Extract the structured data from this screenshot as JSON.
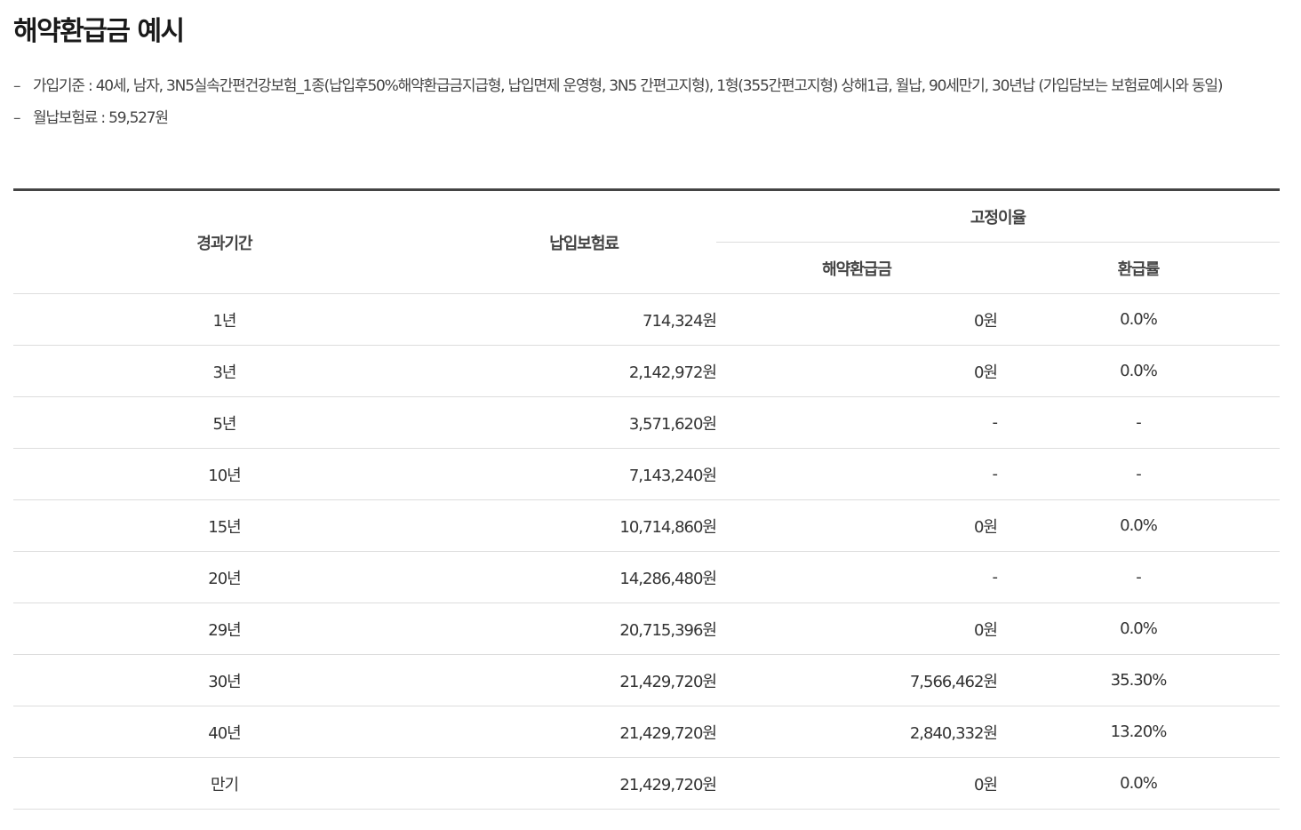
{
  "title": "해약환급금 예시",
  "notes": [
    {
      "bullet": "–",
      "text": "가입기준 : 40세, 남자, 3N5실속간편건강보험_1종(납입후50%해약환급금지급형, 납입면제 운영형, 3N5 간편고지형), 1형(355간편고지형) 상해1급, 월납, 90세만기, 30년납 (가입담보는 보험료예시와 동일)"
    },
    {
      "bullet": "–",
      "text": "월납보험료 : 59,527원"
    }
  ],
  "table": {
    "headers": {
      "period": "경과기간",
      "premium": "납입보험료",
      "group": "고정이율",
      "refund": "해약환급금",
      "rate": "환급률"
    },
    "rows": [
      {
        "period": "1년",
        "premium": "714,324원",
        "refund": "0원",
        "rate": "0.0%"
      },
      {
        "period": "3년",
        "premium": "2,142,972원",
        "refund": "0원",
        "rate": "0.0%"
      },
      {
        "period": "5년",
        "premium": "3,571,620원",
        "refund": "-",
        "rate": "-"
      },
      {
        "period": "10년",
        "premium": "7,143,240원",
        "refund": "-",
        "rate": "-"
      },
      {
        "period": "15년",
        "premium": "10,714,860원",
        "refund": "0원",
        "rate": "0.0%"
      },
      {
        "period": "20년",
        "premium": "14,286,480원",
        "refund": "-",
        "rate": "-"
      },
      {
        "period": "29년",
        "premium": "20,715,396원",
        "refund": "0원",
        "rate": "0.0%"
      },
      {
        "period": "30년",
        "premium": "21,429,720원",
        "refund": "7,566,462원",
        "rate": "35.30%"
      },
      {
        "period": "40년",
        "premium": "21,429,720원",
        "refund": "2,840,332원",
        "rate": "13.20%"
      },
      {
        "period": "만기",
        "premium": "21,429,720원",
        "refund": "0원",
        "rate": "0.0%"
      }
    ]
  }
}
